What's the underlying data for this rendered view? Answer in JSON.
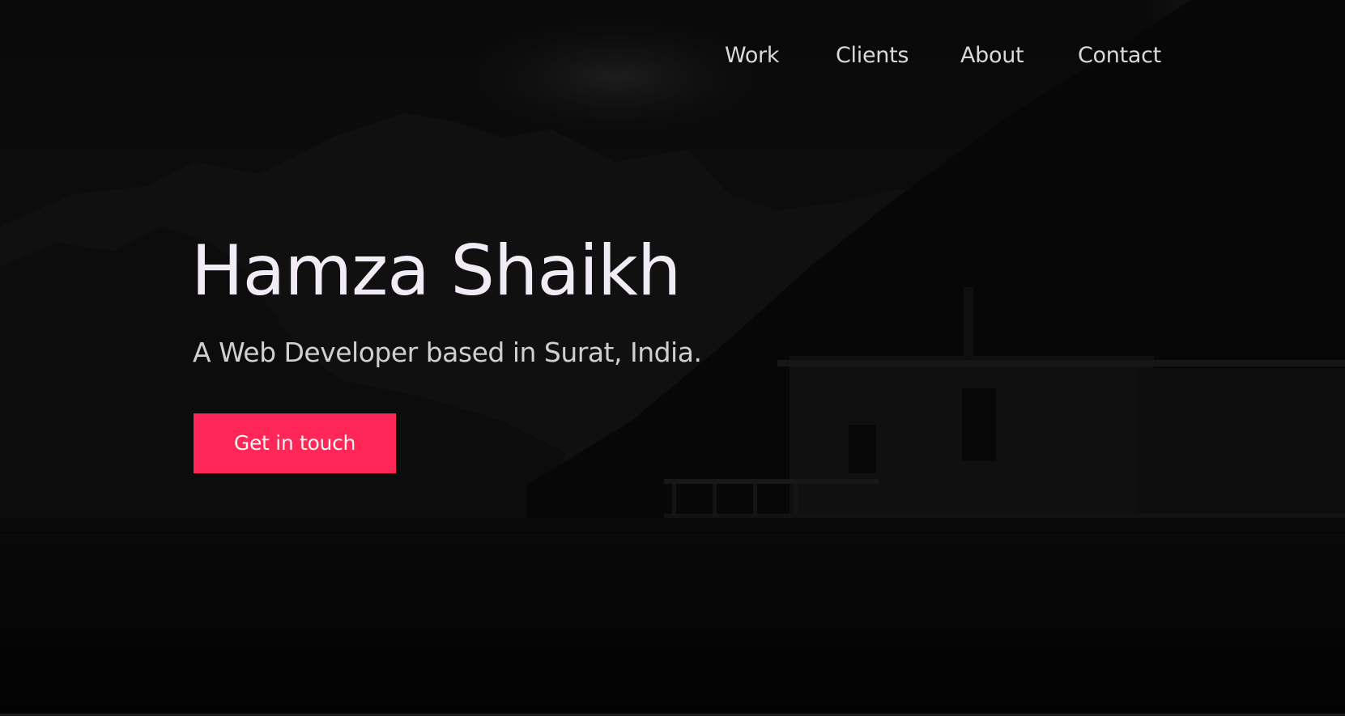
{
  "nav": {
    "items": [
      {
        "label": "Work"
      },
      {
        "label": "Clients"
      },
      {
        "label": "About"
      },
      {
        "label": "Contact"
      }
    ]
  },
  "hero": {
    "name": "Hamza Shaikh",
    "tagline": "A Web Developer based in Surat, India.",
    "cta_label": "Get in touch"
  },
  "colors": {
    "accent": "#ff2757",
    "background": "#050505",
    "text_primary": "#f1ebf5",
    "text_secondary": "#cfcfcf"
  }
}
